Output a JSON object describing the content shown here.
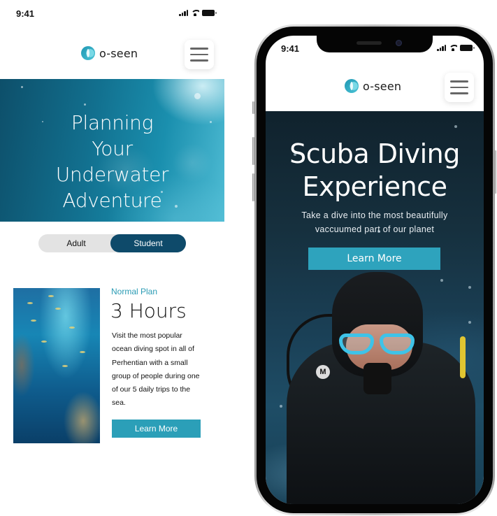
{
  "left_screen": {
    "status_bar": {
      "time": "9:41"
    },
    "header": {
      "brand": "o-seen",
      "menu_icon": "hamburger-icon"
    },
    "hero": {
      "title": "Planning Your Underwater Adventure"
    },
    "audience_toggle": {
      "options": [
        {
          "label": "Adult",
          "selected": false
        },
        {
          "label": "Student",
          "selected": true
        }
      ]
    },
    "plan": {
      "label": "Normal Plan",
      "title": "3 Hours",
      "description": "Visit the most popular ocean diving spot in all of Perhentian with a small group of people during one of our 5 daily trips to the sea.",
      "button_label": "Learn More"
    }
  },
  "right_screen": {
    "status_bar": {
      "time": "9:41"
    },
    "header": {
      "brand": "o-seen",
      "menu_icon": "hamburger-icon"
    },
    "hero": {
      "title": "Scuba Diving Experience",
      "subtitle": "Take a dive into the most beautifully vaccuumed part of our planet",
      "button_label": "Learn More",
      "badge_letter": "M"
    }
  },
  "colors": {
    "accent_teal": "#2b9fb8",
    "toggle_active": "#0e4a6a",
    "toggle_inactive": "#e3e3e3",
    "plan_label": "#2a9bb4"
  }
}
